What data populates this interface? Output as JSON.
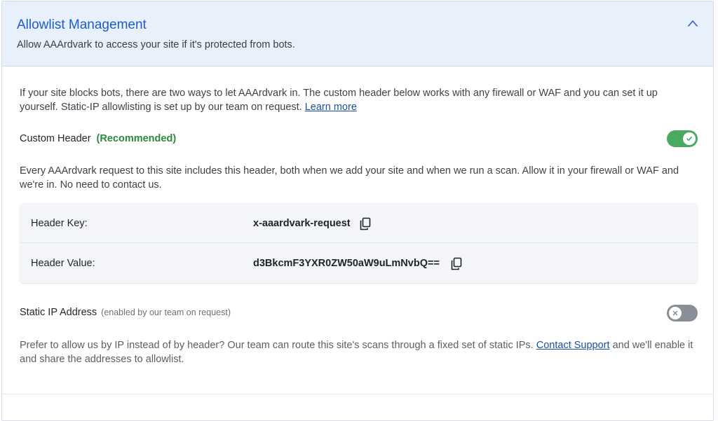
{
  "header": {
    "title": "Allowlist Management",
    "subtitle": "Allow AAArdvark to access your site if it's protected from bots.",
    "collapse_icon": "chevron-up-icon",
    "accent_color": "#1e5cc8",
    "background_color": "#e8f0fb"
  },
  "intro": {
    "text": "If your site blocks bots, there are two ways to let AAArdvark in. The custom header below works with any firewall or WAF and you can set it up yourself. Static-IP allowlisting is set up by our team on request. ",
    "link_label": "Learn more"
  },
  "custom_header": {
    "label": "Custom Header",
    "badge": "(Recommended)",
    "badge_color": "#2a8a3c",
    "toggle_on": true,
    "toggle_color": "#4aaa62",
    "description": "Every AAArdvark request to this site includes this header, both when we add your site and when we run a scan. Allow it in your firewall or WAF and we're in. No need to contact us.",
    "rows": [
      {
        "label": "Header Key:",
        "value": "x-aaardvark-request",
        "icon": "copy-icon"
      },
      {
        "label": "Header Value:",
        "value": "d3BkcmF3YXR0ZW50aW9uLmNvbQ==",
        "icon": "copy-icon"
      }
    ]
  },
  "static_ip": {
    "label": "Static IP Address",
    "note": "(enabled by our team on request)",
    "toggle_on": false,
    "toggle_color": "#8a8f97",
    "description_before": "Prefer to allow us by IP instead of by header? Our team can route this site's scans through a fixed set of static IPs. ",
    "link_label": "Contact Support",
    "description_after": " and we'll enable it and share the addresses to allowlist."
  }
}
